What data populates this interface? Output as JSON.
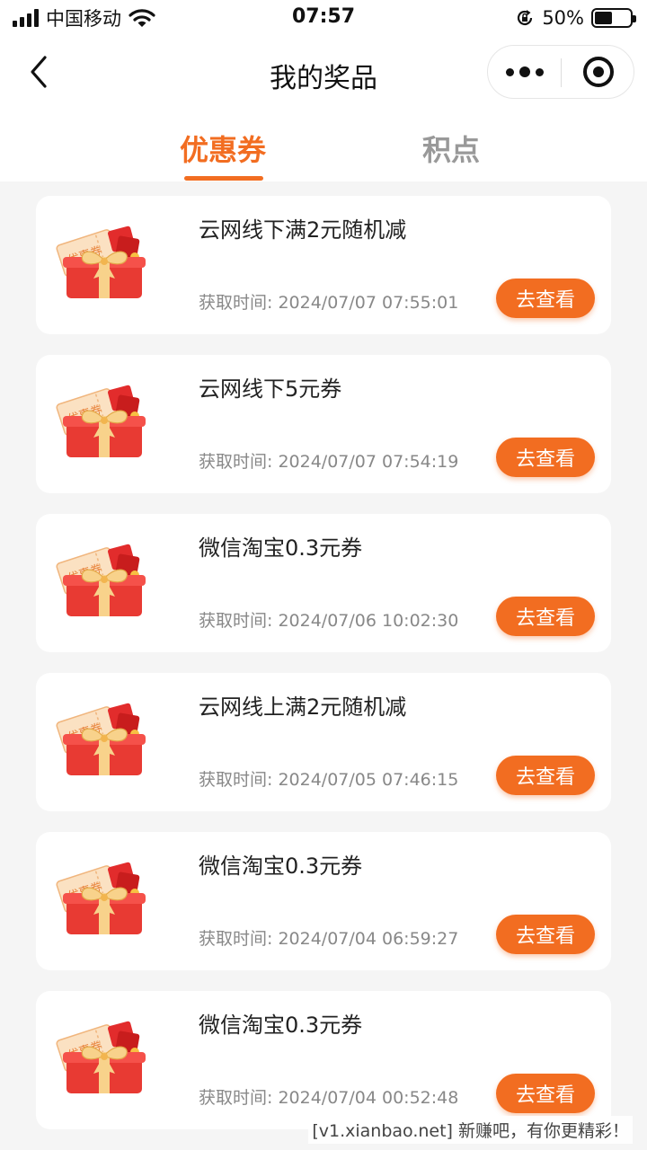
{
  "status_bar": {
    "carrier": "中国移动",
    "time": "07:57",
    "battery_percent": "50%",
    "battery_level": 0.5
  },
  "nav": {
    "title": "我的奖品",
    "icons": {
      "back": "back-arrow-icon",
      "more": "more-dots-icon",
      "close": "target-close-icon"
    }
  },
  "tabs": [
    {
      "label": "优惠券",
      "active": true
    },
    {
      "label": "积点",
      "active": false
    }
  ],
  "colors": {
    "accent": "#f26d21",
    "inactive_tab": "#999999",
    "background": "#f5f5f5"
  },
  "coupons": [
    {
      "title": "云网线下满2元随机减",
      "time": "获取时间: 2024/07/07 07:55:01",
      "button": "去查看",
      "image_text": "优惠券"
    },
    {
      "title": "云网线下5元券",
      "time": "获取时间: 2024/07/07 07:54:19",
      "button": "去查看",
      "image_text": "优惠券"
    },
    {
      "title": "微信淘宝0.3元券",
      "time": "获取时间: 2024/07/06 10:02:30",
      "button": "去查看",
      "image_text": "优惠券"
    },
    {
      "title": "云网线上满2元随机减",
      "time": "获取时间: 2024/07/05 07:46:15",
      "button": "去查看",
      "image_text": "优惠券"
    },
    {
      "title": "微信淘宝0.3元券",
      "time": "获取时间: 2024/07/04 06:59:27",
      "button": "去查看",
      "image_text": "优惠券"
    },
    {
      "title": "微信淘宝0.3元券",
      "time": "获取时间: 2024/07/04 00:52:48",
      "button": "去查看",
      "image_text": "优惠券"
    }
  ],
  "watermark": "[v1.xianbao.net] 新赚吧，有你更精彩！"
}
